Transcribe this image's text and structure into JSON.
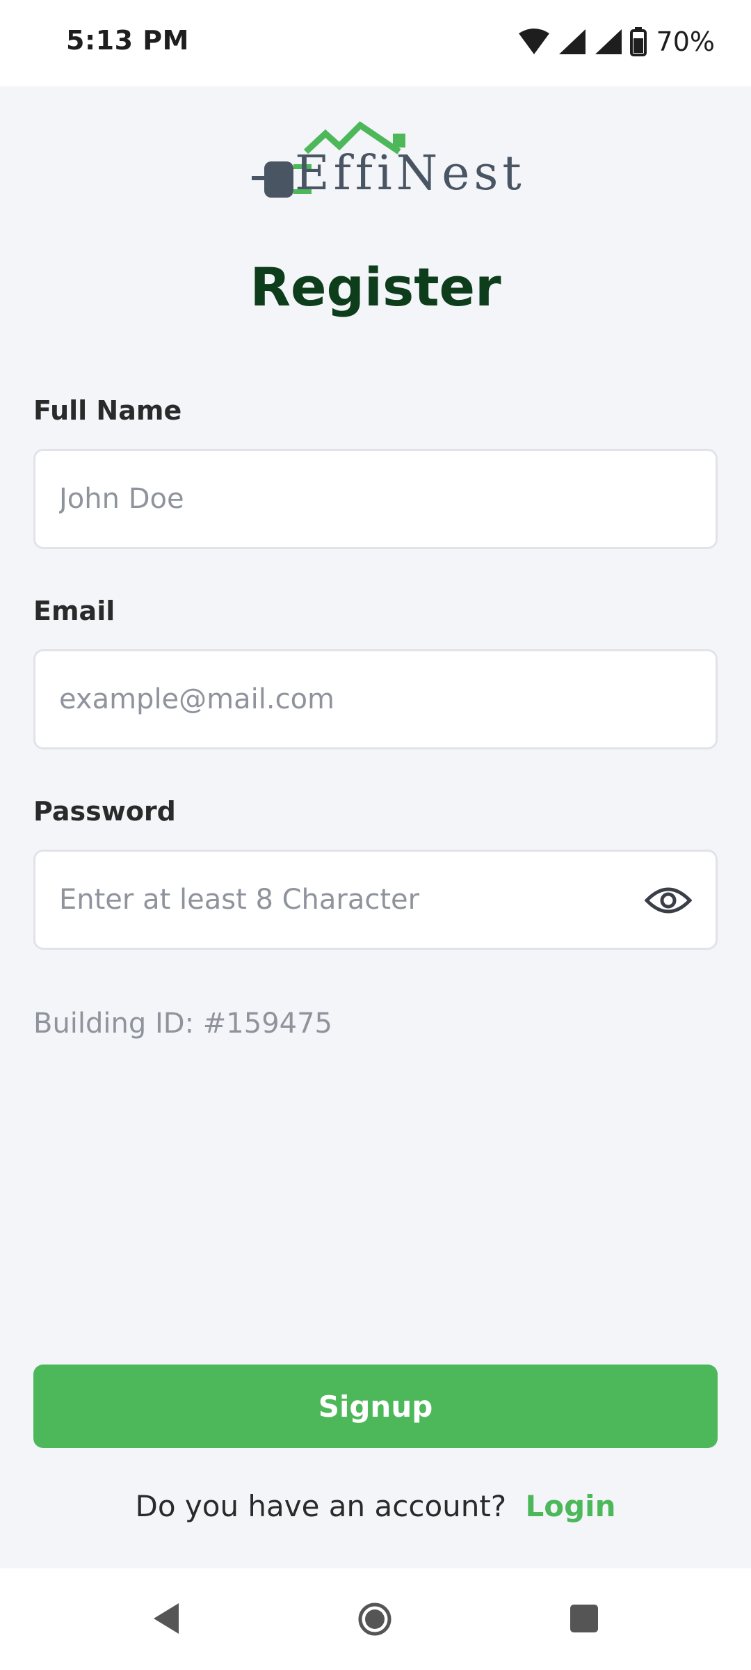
{
  "status_bar": {
    "time": "5:13 PM",
    "battery_percent": "70%"
  },
  "brand": {
    "logo_text": "EffiNest",
    "green": "#4cb85a",
    "dark_green": "#0d3d1b",
    "slate": "#4a5564"
  },
  "page": {
    "title": "Register"
  },
  "form": {
    "full_name": {
      "label": "Full Name",
      "value": "",
      "placeholder": "John Doe"
    },
    "email": {
      "label": "Email",
      "value": "",
      "placeholder": "example@mail.com"
    },
    "password": {
      "label": "Password",
      "value": "",
      "placeholder": "Enter at least 8 Character",
      "toggle_icon": "eye-icon"
    },
    "building_id_label": "Building ID:",
    "building_id_value": "#159475"
  },
  "actions": {
    "signup_label": "Signup",
    "account_prompt": "Do you have an account?",
    "login_label": "Login"
  },
  "nav_bar": {
    "icons": [
      "back-icon",
      "home-icon",
      "recents-icon"
    ]
  }
}
